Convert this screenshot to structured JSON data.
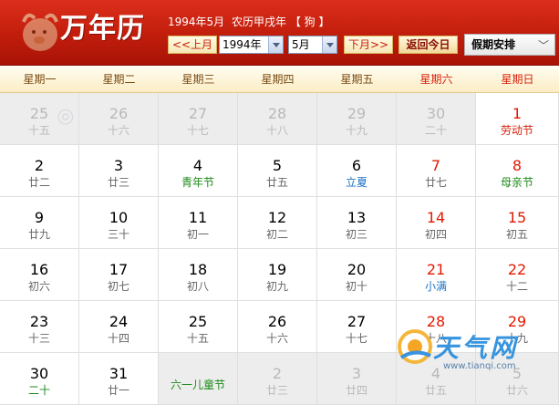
{
  "app": {
    "title": "万年历"
  },
  "header_info": {
    "date_text": "1994年5月",
    "lunar_text": "农历甲戌年",
    "zodiac": "【 狗 】"
  },
  "controls": {
    "prev_label": "<<上月",
    "next_label": "下月>>",
    "year_value": "1994年",
    "month_value": "5月",
    "today_label": "返回今日",
    "holiday_label": "假期安排",
    "holiday_icon": "chevron-down-icon"
  },
  "weekdays": [
    "星期一",
    "星期二",
    "星期三",
    "星期四",
    "星期五",
    "星期六",
    "星期日"
  ],
  "colors": {
    "header_red": "#c11d0c",
    "holiday_red": "#e41800",
    "festival_green": "#1b8a16",
    "solar_term_blue": "#1b73c7"
  },
  "days": [
    {
      "num": "25",
      "lunar": "十五",
      "out": true
    },
    {
      "num": "26",
      "lunar": "十六",
      "out": true
    },
    {
      "num": "27",
      "lunar": "十七",
      "out": true
    },
    {
      "num": "28",
      "lunar": "十八",
      "out": true
    },
    {
      "num": "29",
      "lunar": "十九",
      "out": true
    },
    {
      "num": "30",
      "lunar": "二十",
      "out": true
    },
    {
      "num": "1",
      "lunar": "劳动节",
      "num_style": "red",
      "lunar_style": "red"
    },
    {
      "num": "2",
      "lunar": "廿二"
    },
    {
      "num": "3",
      "lunar": "廿三"
    },
    {
      "num": "4",
      "lunar": "青年节",
      "lunar_style": "green"
    },
    {
      "num": "5",
      "lunar": "廿五"
    },
    {
      "num": "6",
      "lunar": "立夏",
      "lunar_style": "blue"
    },
    {
      "num": "7",
      "lunar": "廿七",
      "num_style": "red"
    },
    {
      "num": "8",
      "lunar": "母亲节",
      "num_style": "red",
      "lunar_style": "green"
    },
    {
      "num": "9",
      "lunar": "廿九"
    },
    {
      "num": "10",
      "lunar": "三十"
    },
    {
      "num": "11",
      "lunar": "初一"
    },
    {
      "num": "12",
      "lunar": "初二"
    },
    {
      "num": "13",
      "lunar": "初三"
    },
    {
      "num": "14",
      "lunar": "初四",
      "num_style": "red"
    },
    {
      "num": "15",
      "lunar": "初五",
      "num_style": "red"
    },
    {
      "num": "16",
      "lunar": "初六"
    },
    {
      "num": "17",
      "lunar": "初七"
    },
    {
      "num": "18",
      "lunar": "初八"
    },
    {
      "num": "19",
      "lunar": "初九"
    },
    {
      "num": "20",
      "lunar": "初十"
    },
    {
      "num": "21",
      "lunar": "小满",
      "num_style": "red",
      "lunar_style": "blue"
    },
    {
      "num": "22",
      "lunar": "十二",
      "num_style": "red"
    },
    {
      "num": "23",
      "lunar": "十三"
    },
    {
      "num": "24",
      "lunar": "十四"
    },
    {
      "num": "25",
      "lunar": "十五"
    },
    {
      "num": "26",
      "lunar": "十六"
    },
    {
      "num": "27",
      "lunar": "十七"
    },
    {
      "num": "28",
      "lunar": "十八",
      "num_style": "red"
    },
    {
      "num": "29",
      "lunar": "十九",
      "num_style": "red"
    },
    {
      "num": "30",
      "lunar": "二十",
      "lunar_style": "green"
    },
    {
      "num": "31",
      "lunar": "廿一"
    },
    {
      "num": "",
      "lunar": "六一儿童节",
      "out": true,
      "lunar_style": "green"
    },
    {
      "num": "2",
      "lunar": "廿三",
      "out": true
    },
    {
      "num": "3",
      "lunar": "廿四",
      "out": true
    },
    {
      "num": "4",
      "lunar": "廿五",
      "out": true
    },
    {
      "num": "5",
      "lunar": "廿六",
      "out": true
    }
  ],
  "watermark": {
    "brand": "天气网",
    "url": "www.tianqi.com"
  }
}
